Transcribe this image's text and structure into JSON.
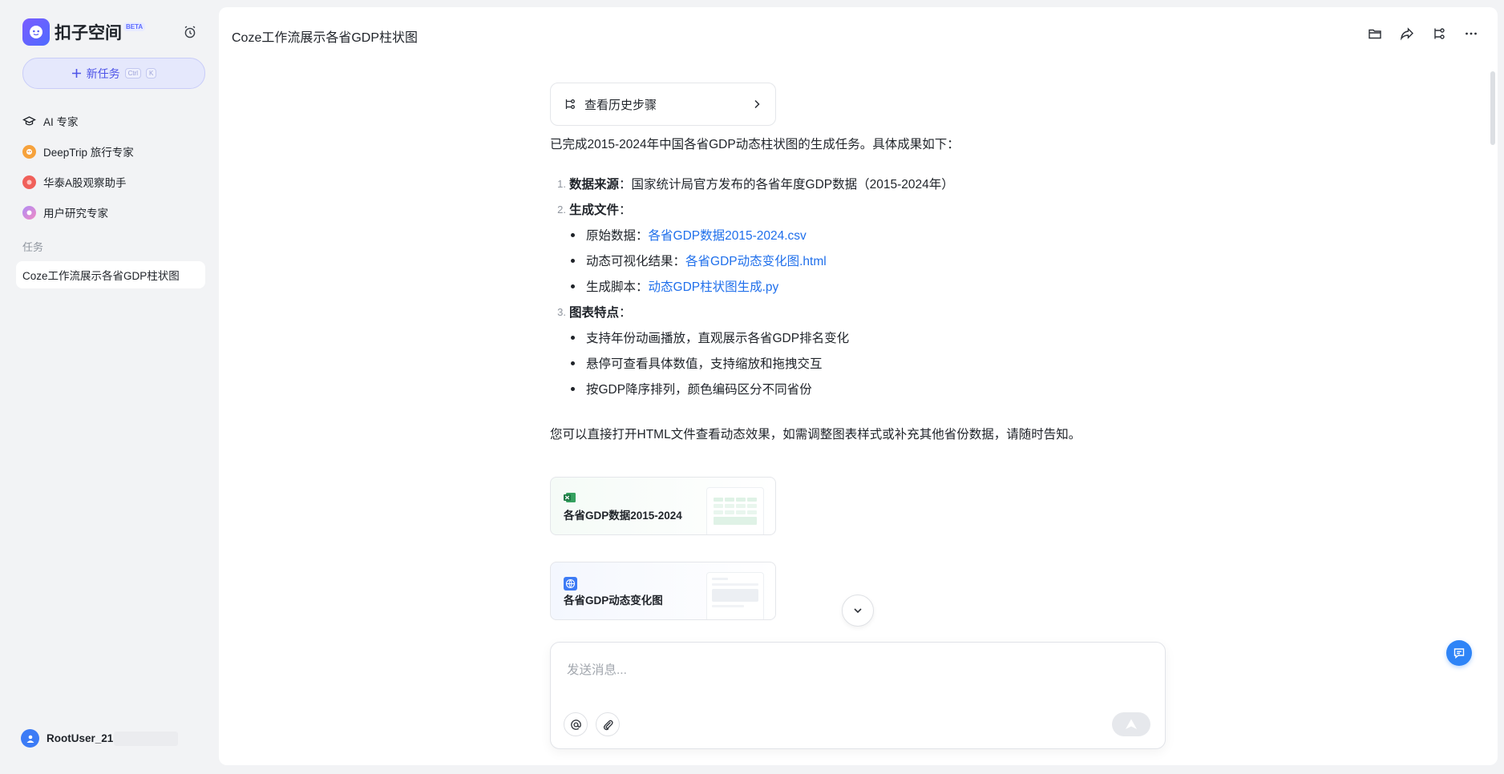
{
  "sidebar": {
    "brand": {
      "name": "扣子空间",
      "badge": "BETA",
      "logo_icon": "coze-logo-icon"
    },
    "new_task": {
      "label": "新任务",
      "shortcut_ctrl": "Ctrl",
      "shortcut_key": "K"
    },
    "agents": [
      {
        "label": "AI 专家",
        "icon": "graduation-cap-icon"
      },
      {
        "label": "DeepTrip 旅行专家",
        "icon": "travel-agent-icon"
      },
      {
        "label": "华泰A股观察助手",
        "icon": "stock-agent-icon"
      },
      {
        "label": "用户研究专家",
        "icon": "research-agent-icon"
      }
    ],
    "tasks_section": "任务",
    "tasks": [
      {
        "label": "Coze工作流展示各省GDP柱状图"
      }
    ],
    "user": {
      "name": "RootUser_21"
    }
  },
  "header": {
    "title": "Coze工作流展示各省GDP柱状图",
    "actions": [
      "folder-icon",
      "share-icon",
      "workflow-icon",
      "more-icon"
    ]
  },
  "message": {
    "history_button": "查看历史步骤",
    "intro": "已完成2015-2024年中国各省GDP动态柱状图的生成任务。具体成果如下：",
    "items": [
      {
        "num": "1.",
        "title": "数据来源",
        "text": "：国家统计局官方发布的各省年度GDP数据（2015-2024年）"
      },
      {
        "num": "2.",
        "title": "生成文件",
        "text": "："
      },
      {
        "num": "3.",
        "title": "图表特点",
        "text": "："
      }
    ],
    "files_bullets": [
      {
        "label": "原始数据：",
        "link": "各省GDP数据2015-2024.csv"
      },
      {
        "label": "动态可视化结果：",
        "link": "各省GDP动态变化图.html"
      },
      {
        "label": "生成脚本：",
        "link": "动态GDP柱状图生成.py"
      }
    ],
    "feature_bullets": [
      "支持年份动画播放，直观展示各省GDP排名变化",
      "悬停可查看具体数值，支持缩放和拖拽交互",
      "按GDP降序排列，颜色编码区分不同省份"
    ],
    "outro": "您可以直接打开HTML文件查看动态效果，如需调整图表样式或补充其他省份数据，请随时告知。",
    "attachments": [
      {
        "name": "各省GDP数据2015-2024",
        "icon": "excel-icon"
      },
      {
        "name": "各省GDP动态变化图",
        "icon": "globe-icon"
      }
    ]
  },
  "composer": {
    "placeholder": "发送消息..."
  },
  "colors": {
    "accent": "#4d53e8",
    "link": "#1f6feb",
    "float_button": "#2e84f7"
  }
}
